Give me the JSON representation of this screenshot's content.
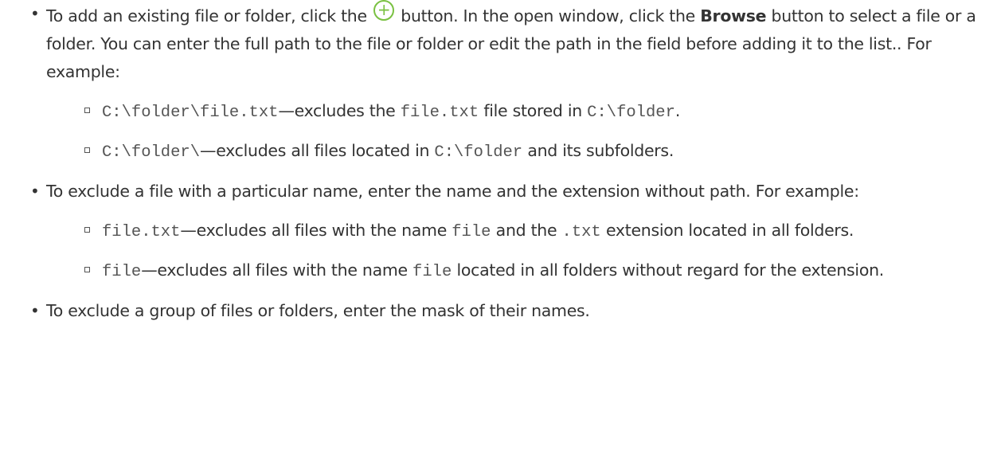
{
  "items": [
    {
      "before_icon": "To add an existing file or folder, click the",
      "icon": "plus-circle-icon",
      "icon_glyph": "+",
      "after_icon_1": "button. In the open window, click the",
      "bold": "Browse",
      "after_bold": "button to select a file or a folder. You can enter the full path to the file or folder or edit the path in the field before adding it to the list.. For example:",
      "sub": [
        {
          "code1": "C:\\folder\\file.txt",
          "text1": "—excludes the ",
          "code2": "file.txt",
          "text2": " file stored in ",
          "code3": "C:\\folder",
          "text3": "."
        },
        {
          "code1": "C:\\folder\\",
          "text1": "—excludes all files located in ",
          "code2": "C:\\folder",
          "text2": " and its subfolders."
        }
      ]
    },
    {
      "text": "To exclude a file with a particular name, enter the name and the extension without path. For example:",
      "sub": [
        {
          "code1": "file.txt",
          "text1": "—excludes all files with the name ",
          "code2": "file",
          "text2": " and the ",
          "code3": ".txt",
          "text3": " extension located in all folders."
        },
        {
          "code1": "file",
          "text1": "—excludes all files with the name ",
          "code2": "file",
          "text2": " located in all folders without regard for the extension."
        }
      ]
    },
    {
      "text": "To exclude a group of files or folders, enter the mask of their names."
    }
  ],
  "colors": {
    "text": "#333333",
    "code": "#555555",
    "accent": "#7ac142"
  }
}
